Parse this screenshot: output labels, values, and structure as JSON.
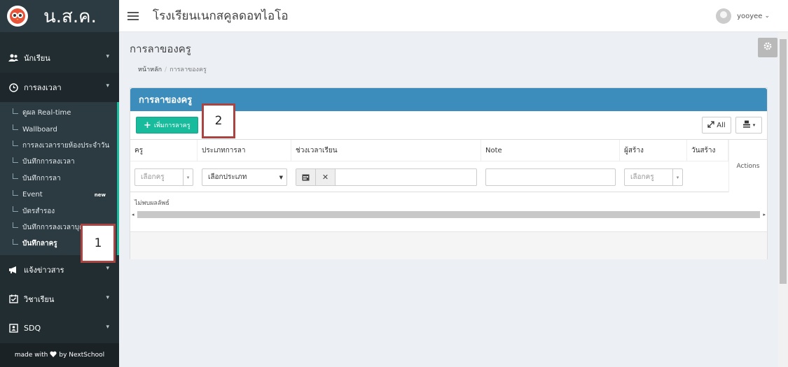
{
  "brand": {
    "title": "น.ส.ค."
  },
  "header": {
    "school_name": "โรงเรียนเนกสคูลดอทไอโอ",
    "username": "yooyee",
    "user_chevron": "⌄"
  },
  "sidebar": {
    "items": [
      {
        "label": "นักเรียน",
        "icon": "users-icon"
      },
      {
        "label": "การลงเวลา",
        "icon": "clock-icon"
      },
      {
        "label": "แจ้งข่าวสาร",
        "icon": "megaphone-icon"
      },
      {
        "label": "วิชาเรียน",
        "icon": "calendar-check-icon"
      },
      {
        "label": "SDQ",
        "icon": "id-card-icon"
      }
    ],
    "subitems": [
      {
        "label": "ดูผล Real-time"
      },
      {
        "label": "Wallboard"
      },
      {
        "label": "การลงเวลารายห้องประจำวัน"
      },
      {
        "label": "บันทึกการลงเวลา"
      },
      {
        "label": "บันทึกการลา"
      },
      {
        "label": "Event",
        "badge": "new"
      },
      {
        "label": "บัตรสำรอง"
      },
      {
        "label": "บันทึกการลงเวลาบุคล"
      },
      {
        "label": "บันทึกลาครู"
      }
    ],
    "footer": {
      "made_with": "made with",
      "by": "by NextSchool"
    }
  },
  "page": {
    "title": "การลาของครู",
    "breadcrumb": {
      "home": "หน้าหลัก",
      "sep": "/",
      "current": "การลาของครู"
    }
  },
  "box": {
    "title": "การลาของครู",
    "add_button": "เพิ่มการลาครู",
    "all_button": "All",
    "columns": [
      "ครู",
      "ประเภทการลา",
      "ช่วงเวลาเรียน",
      "Note",
      "ผู้สร้าง",
      "วันสร้าง"
    ],
    "actions_label": "Actions",
    "filters": {
      "teacher_placeholder": "เลือกครู",
      "type_selected": "เลือกประเภท",
      "creator_placeholder": "เลือกครู"
    },
    "empty_text": "ไม่พบผลลัพธ์"
  },
  "annotations": {
    "one": "1",
    "two": "2"
  },
  "colors": {
    "sidebar": "#222d32",
    "accent_green": "#18bc9c",
    "box_header": "#3c8dbc",
    "annotation_border": "#a94442"
  }
}
